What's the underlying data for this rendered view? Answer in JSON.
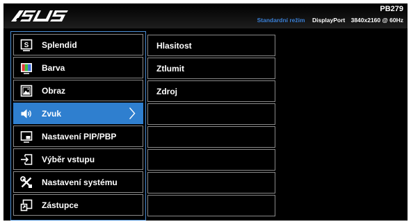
{
  "header": {
    "brand": "ASUS",
    "model": "PB279",
    "mode": "Standardní režim",
    "port": "DisplayPort",
    "resolution": "3840x2160 @ 60Hz"
  },
  "menu": {
    "items": [
      {
        "label": "Splendid",
        "icon": "splendid-icon"
      },
      {
        "label": "Barva",
        "icon": "color-icon"
      },
      {
        "label": "Obraz",
        "icon": "image-icon"
      },
      {
        "label": "Zvuk",
        "icon": "speaker-icon",
        "active": true
      },
      {
        "label": "Nastavení PIP/PBP",
        "icon": "pip-icon"
      },
      {
        "label": "Výběr vstupu",
        "icon": "input-icon"
      },
      {
        "label": "Nastavení systému",
        "icon": "tools-icon"
      },
      {
        "label": "Zástupce",
        "icon": "shortcut-icon"
      }
    ]
  },
  "submenu": {
    "items": [
      {
        "label": "Hlasitost"
      },
      {
        "label": "Ztlumit"
      },
      {
        "label": "Zdroj"
      },
      {
        "label": ""
      },
      {
        "label": ""
      },
      {
        "label": ""
      },
      {
        "label": ""
      },
      {
        "label": ""
      }
    ]
  },
  "colors": {
    "accent": "#2f7fcf",
    "mode_text": "#3a7fd5",
    "border": "#8a8a8a",
    "background": "#000000"
  }
}
